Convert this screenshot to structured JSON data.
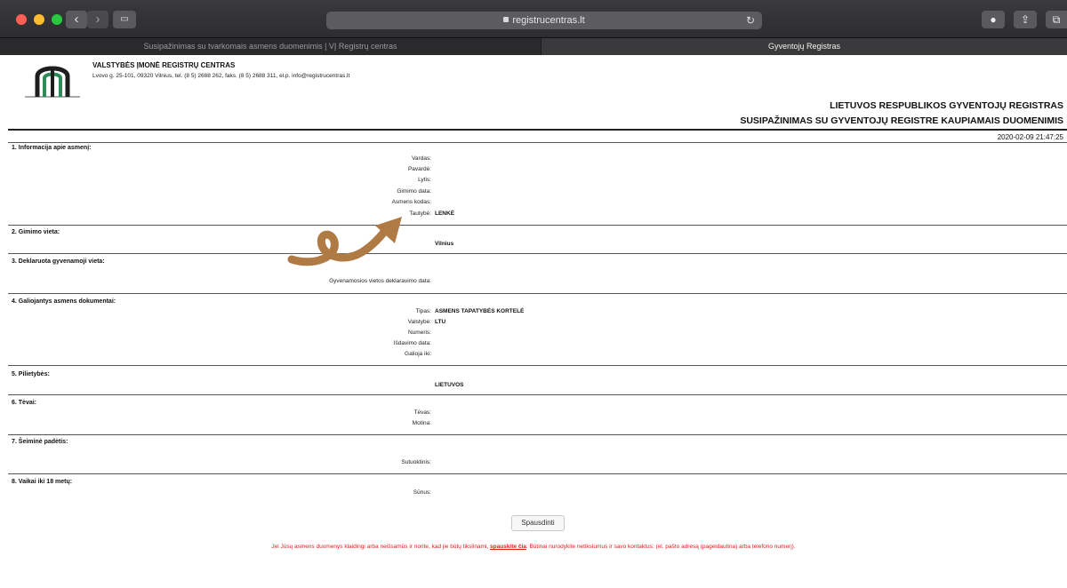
{
  "browser": {
    "url": "registrucentras.lt",
    "tabs": [
      {
        "label": "Susipažinimas su tvarkomais asmens duomenimis | VĮ Registrų centras",
        "active": false
      },
      {
        "label": "Gyventojų Registras",
        "active": true
      }
    ]
  },
  "header": {
    "org_name": "VALSTYBĖS ĮMONĖ REGISTRŲ CENTRAS",
    "org_address": "Lvovo g. 25-101, 09320 Vilnius, tel. (8 5) 2688 262, faks. (8 5) 2688 311, el.p. info@registrucentras.lt",
    "title_line1": "LIETUVOS RESPUBLIKOS GYVENTOJŲ REGISTRAS",
    "title_line2": "SUSIPAŽINIMAS SU GYVENTOJŲ REGISTRE KAUPIAMAIS DUOMENIMIS",
    "datetime": "2020-02-09 21:47:25"
  },
  "sections": {
    "s1": {
      "title": "1. Informacija apie asmenį:",
      "vardas": "Vardas:",
      "pavarde": "Pavardė:",
      "lytis": "Lytis:",
      "gimimo_data": "Gimimo data:",
      "asmens_kodas": "Asmens kodas:",
      "tautybe": "Tautybė:",
      "tautybe_value": "LENKĖ"
    },
    "s2": {
      "title": "2. Gimimo vieta:",
      "value": "Vilnius"
    },
    "s3": {
      "title": "3. Deklaruota gyvenamoji vieta:",
      "label": "Gyvenamosios vietos deklaravimo data:"
    },
    "s4": {
      "title": "4. Galiojantys asmens dokumentai:",
      "tipas": "Tipas:",
      "tipas_value": "ASMENS TAPATYBĖS KORTELĖ",
      "valstybe": "Valstybė:",
      "valstybe_value": "LTU",
      "numeris": "Numeris:",
      "isdavimo_data": "Išdavimo data:",
      "galioja_iki": "Galioja iki:"
    },
    "s5": {
      "title": "5. Pilietybės:",
      "value": "LIETUVOS"
    },
    "s6": {
      "title": "6. Tėvai:",
      "tevas": "Tėvas:",
      "motina": "Motina:"
    },
    "s7": {
      "title": "7. Šeiminė padėtis:",
      "sutuoktinis": "Sutuoktinis:"
    },
    "s8": {
      "title": "8. Vaikai iki 18 metų:",
      "sunus": "Sūnus:"
    }
  },
  "print_button": "Spausdinti",
  "notice": {
    "before": "Jei Jūsų asmens duomenys klaidingi arba neišsamūs ir norite, kad jie būtų tikslinami,",
    "link": "spauskite čia",
    "after": ". Būtinai nurodykite netikslumus ir savo kontaktus: (el. pašto adresą (pageidautina) arba telefono numerį)."
  },
  "colors": {
    "notice": "#e21b1b",
    "arrow": "#b07a45"
  }
}
